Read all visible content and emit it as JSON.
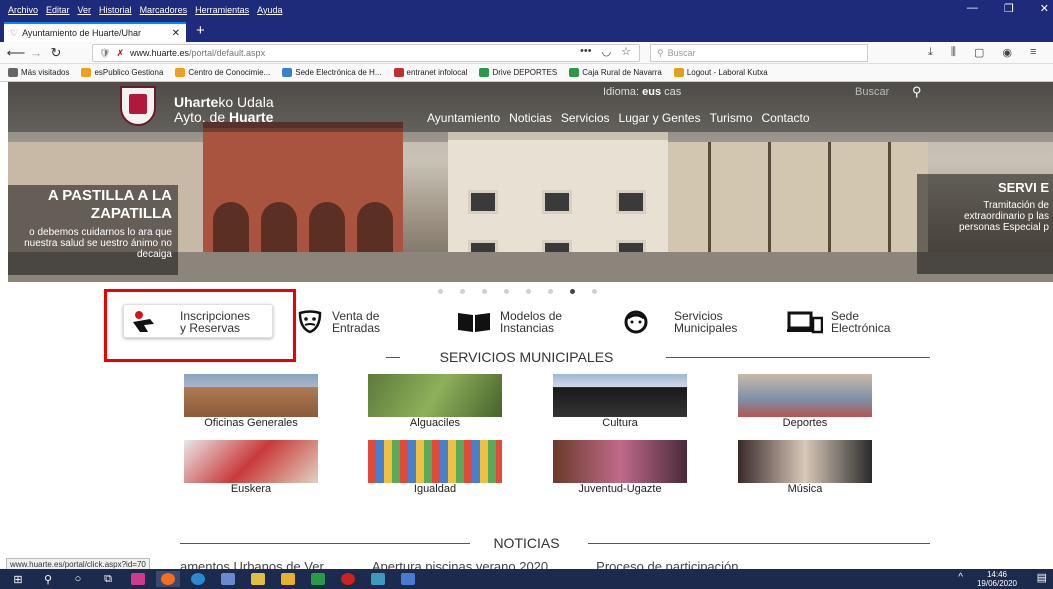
{
  "browser": {
    "menu": [
      "Archivo",
      "Editar",
      "Ver",
      "Historial",
      "Marcadores",
      "Herramientas",
      "Ayuda"
    ],
    "tab_title": "Ayuntamiento de Huarte/Uhar",
    "url_domain": "www.huarte.es",
    "url_path": "/portal/default.aspx",
    "search_placeholder": "Buscar",
    "bookmarks": [
      {
        "label": "Más visitados",
        "color": "#666666"
      },
      {
        "label": "esPublico Gestiona",
        "color": "#f0a020"
      },
      {
        "label": "Centro de Conocimie...",
        "color": "#f0a020"
      },
      {
        "label": "Sede Electrónica de H...",
        "color": "#3a7fd0"
      },
      {
        "label": "entranet infolocal",
        "color": "#c03030"
      },
      {
        "label": "Drive DEPORTES",
        "color": "#2a9a4a"
      },
      {
        "label": "Caja Rural de Navarra",
        "color": "#2a9a4a"
      },
      {
        "label": "Logout - Laboral Kutxa",
        "color": "#e0a020"
      }
    ],
    "status_url": "www.huarte.es/portal/click.aspx?id=70"
  },
  "site": {
    "brand_line1_bold": "Uharte",
    "brand_line1_rest": "ko Udala",
    "brand_line2_rest": "Ayto. de ",
    "brand_line2_bold": "Huarte",
    "lang_label": "Idioma:",
    "lang_eus": "eus",
    "lang_cas": "cas",
    "search_label": "Buscar",
    "nav": [
      "Ayuntamiento",
      "Noticias",
      "Servicios",
      "Lugar y Gentes",
      "Turismo",
      "Contacto"
    ]
  },
  "slides": {
    "left_title": "A PASTILLA A LA ZAPATILLA",
    "left_text": "o debemos cuidarnos lo ara que nuestra salud se uestro ánimo no decaiga",
    "right_title": "SERVI E",
    "right_text": "Tramitación de extraordinario p las personas Especial p"
  },
  "carousel": {
    "count": 8,
    "active": 6
  },
  "quick_links": [
    {
      "line1": "Inscripciones",
      "line2": "y Reservas"
    },
    {
      "line1": "Venta de",
      "line2": "Entradas"
    },
    {
      "line1": "Modelos de",
      "line2": "Instancias"
    },
    {
      "line1": "Servicios",
      "line2": "Municipales"
    },
    {
      "line1": "Sede",
      "line2": "Electrónica"
    }
  ],
  "services_title": "SERVICIOS MUNICIPALES",
  "services": [
    "Oficinas Generales",
    "Alguaciles",
    "Cultura",
    "Deportes",
    "Euskera",
    "Igualdad",
    "Juventud-Ugazte",
    "Música"
  ],
  "news_title": "NOTICIAS",
  "news_items": [
    "amentos Urbanos de Ver",
    "Apertura piscinas verano 2020",
    "Proceso de participación"
  ],
  "taskbar": {
    "time": "14:46",
    "date": "19/06/2020"
  }
}
